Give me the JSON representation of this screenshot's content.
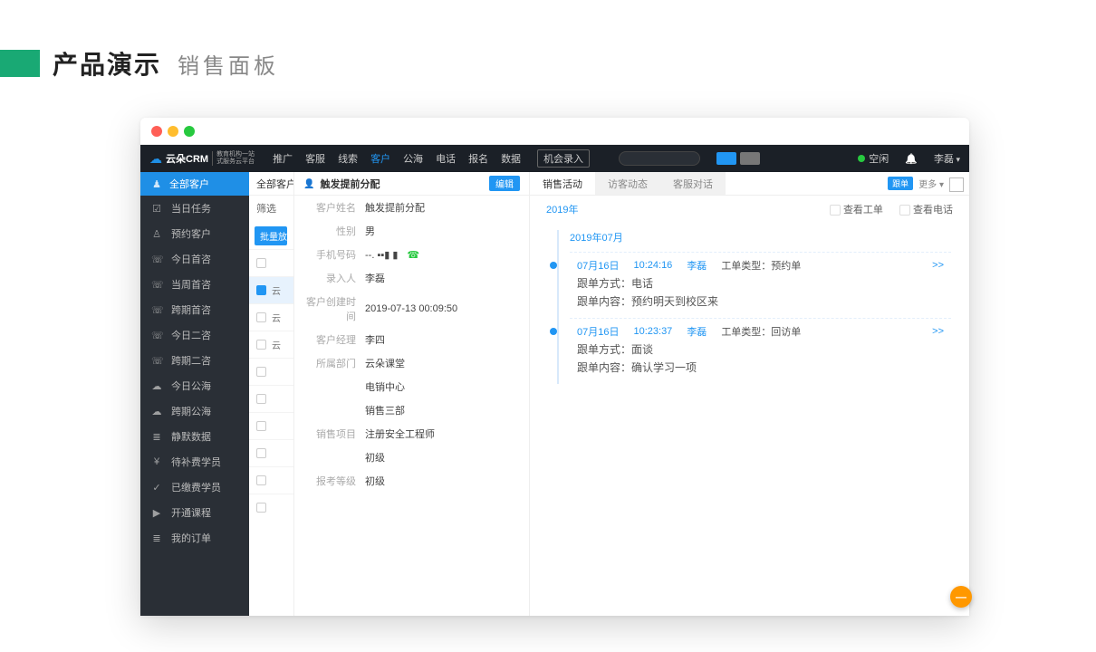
{
  "page": {
    "title": "产品演示",
    "subtitle": "销售面板"
  },
  "topnav": {
    "brand": "云朵CRM",
    "brand_sub1": "教育机构一站",
    "brand_sub2": "式服务云平台",
    "links": [
      "推广",
      "客服",
      "线索",
      "客户",
      "公海",
      "电话",
      "报名",
      "数据"
    ],
    "active_index": 3,
    "chance_btn": "机会录入",
    "status_text": "空闲",
    "user_name": "李磊"
  },
  "sidebar": {
    "top": "全部客户",
    "items": [
      {
        "icon": "☑",
        "label": "当日任务"
      },
      {
        "icon": "♙",
        "label": "预约客户"
      },
      {
        "icon": "☏",
        "label": "今日首咨"
      },
      {
        "icon": "☏",
        "label": "当周首咨"
      },
      {
        "icon": "☏",
        "label": "跨期首咨"
      },
      {
        "icon": "☏",
        "label": "今日二咨"
      },
      {
        "icon": "☏",
        "label": "跨期二咨"
      },
      {
        "icon": "☁",
        "label": "今日公海"
      },
      {
        "icon": "☁",
        "label": "跨期公海"
      },
      {
        "icon": "≣",
        "label": "静默数据"
      },
      {
        "icon": "¥",
        "label": "待补费学员"
      },
      {
        "icon": "✓",
        "label": "已缴费学员"
      },
      {
        "icon": "▶",
        "label": "开通课程"
      },
      {
        "icon": "≣",
        "label": "我的订单"
      }
    ]
  },
  "midcol": {
    "header": "全部客户",
    "filter_label": "筛选",
    "bulk_btn": "批量放",
    "rows": [
      "",
      "云",
      "云",
      "云",
      "",
      "",
      "",
      "",
      "",
      ""
    ],
    "selected_index": 1
  },
  "detail": {
    "title": "触发提前分配",
    "edit_btn": "编辑",
    "fields": [
      {
        "label": "客户姓名",
        "value": "触发提前分配"
      },
      {
        "label": "性别",
        "value": "男"
      },
      {
        "label": "手机号码",
        "value": "--. ▪▪▮ ▮",
        "phone": true
      },
      {
        "label": "录入人",
        "value": "李磊"
      },
      {
        "label": "客户创建时间",
        "value": "2019-07-13 00:09:50"
      },
      {
        "label": "客户经理",
        "value": "李四"
      },
      {
        "label": "所属部门",
        "value": "云朵课堂"
      },
      {
        "label": "",
        "value": "电销中心"
      },
      {
        "label": "",
        "value": "销售三部"
      },
      {
        "label": "销售项目",
        "value": "注册安全工程师"
      },
      {
        "label": "",
        "value": "初级"
      },
      {
        "label": "报考等级",
        "value": "初级"
      }
    ]
  },
  "activity": {
    "tabs": [
      "销售活动",
      "访客动态",
      "客服对话"
    ],
    "active_tab": 0,
    "follow_badge": "跟单",
    "more_label": "更多 ▾",
    "year": "2019年",
    "chk_ticket": "查看工单",
    "chk_call": "查看电话",
    "month": "2019年07月",
    "items": [
      {
        "date": "07月16日",
        "time": "10:24:16",
        "user": "李磊",
        "type_label": "工单类型：",
        "type_value": "预约单",
        "lines": [
          {
            "k": "跟单方式：",
            "v": "电话"
          },
          {
            "k": "跟单内容：",
            "v": "预约明天到校区来"
          }
        ],
        "expand": ">>"
      },
      {
        "date": "07月16日",
        "time": "10:23:37",
        "user": "李磊",
        "type_label": "工单类型：",
        "type_value": "回访单",
        "lines": [
          {
            "k": "跟单方式：",
            "v": "面谈"
          },
          {
            "k": "跟单内容：",
            "v": "确认学习一项"
          }
        ],
        "expand": ">>"
      }
    ]
  },
  "float_btn": "—"
}
